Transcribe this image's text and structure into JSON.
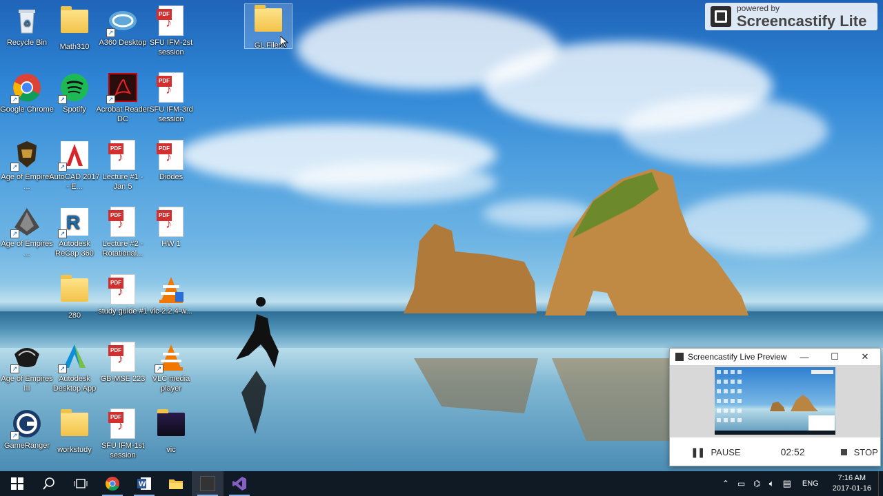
{
  "screencastify_badge": {
    "powered_by": "powered by",
    "brand": "Screencastify Lite"
  },
  "desktop_icons": [
    {
      "label": "Recycle Bin",
      "icon": "recycle-bin-icon"
    },
    {
      "label": "Math310",
      "icon": "folder-icon"
    },
    {
      "label": "A360 Desktop",
      "icon": "a360-icon"
    },
    {
      "label": "SFU IFM-2st session",
      "icon": "pdf-icon"
    },
    {
      "label": "GL Files",
      "icon": "folder-icon"
    },
    {
      "label": "Google Chrome",
      "icon": "chrome-icon"
    },
    {
      "label": "Spotify",
      "icon": "spotify-icon"
    },
    {
      "label": "Acrobat Reader DC",
      "icon": "acrobat-icon"
    },
    {
      "label": "SFU IFM-3rd session",
      "icon": "pdf-icon"
    },
    {
      "label": "Age of Empires ...",
      "icon": "age-of-empires-icon"
    },
    {
      "label": "AutoCAD 2017 - E...",
      "icon": "autocad-icon"
    },
    {
      "label": "Lecture #1 - Jan 5",
      "icon": "pdf-icon"
    },
    {
      "label": "Diodes",
      "icon": "pdf-icon"
    },
    {
      "label": "Age of Empires ...",
      "icon": "age-of-empires-icon"
    },
    {
      "label": "Autodesk ReCap 360",
      "icon": "recap-icon"
    },
    {
      "label": "Lecture #2 - Rotational...",
      "icon": "pdf-icon"
    },
    {
      "label": "HW 1",
      "icon": "pdf-icon"
    },
    {
      "label": "280",
      "icon": "folder-icon"
    },
    {
      "label": "study guide #1",
      "icon": "pdf-icon"
    },
    {
      "label": "vlc-2.2.4-w...",
      "icon": "vlc-icon"
    },
    {
      "label": "Age of Empires III",
      "icon": "age-of-empires-iii-icon"
    },
    {
      "label": "Autodesk Desktop App",
      "icon": "autodesk-app-icon"
    },
    {
      "label": "GB-MSE 223",
      "icon": "pdf-icon"
    },
    {
      "label": "VLC media player",
      "icon": "vlc-icon"
    },
    {
      "label": "GameRanger",
      "icon": "gameranger-icon"
    },
    {
      "label": "workstudy",
      "icon": "folder-icon"
    },
    {
      "label": "SFU IFM-1st session",
      "icon": "pdf-icon"
    },
    {
      "label": "vic",
      "icon": "folder-icon"
    }
  ],
  "preview_window": {
    "title": "Screencastify Live Preview",
    "pause_label": "PAUSE",
    "timer": "02:52",
    "stop_label": "STOP"
  },
  "taskbar": {
    "language": "ENG",
    "time": "7:16 AM",
    "date": "2017-01-16"
  },
  "colors": {
    "taskbar": "#0f1a24",
    "pdf_red": "#d32f2f",
    "folder": "#f2c34a"
  }
}
